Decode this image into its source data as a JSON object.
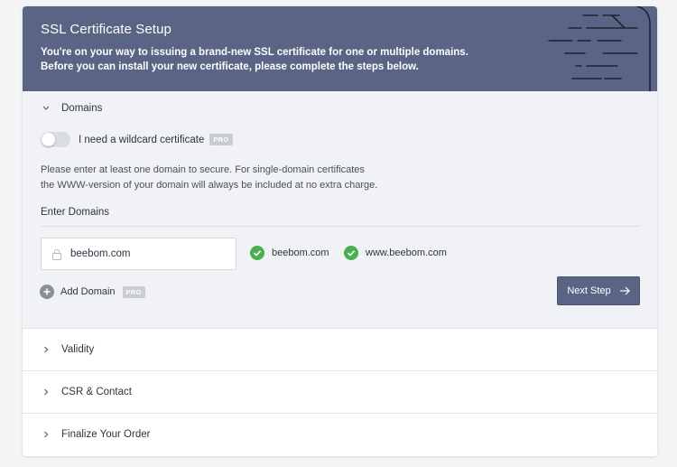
{
  "header": {
    "title": "SSL Certificate Setup",
    "desc_line1": "You're on your way to issuing a brand-new SSL certificate for one or multiple domains.",
    "desc_line2": "Before you can install your new certificate, please complete the steps below."
  },
  "domains_section": {
    "label": "Domains",
    "wildcard_label": "I need a wildcard certificate",
    "wildcard_enabled": false,
    "pro_badge": "PRO",
    "help_line1": "Please enter at least one domain to secure. For single-domain certificates",
    "help_line2": "the WWW-version of your domain will always be included at no extra charge.",
    "enter_label": "Enter Domains",
    "input_value": "beebom.com",
    "verified": [
      "beebom.com",
      "www.beebom.com"
    ],
    "add_domain_label": "Add Domain",
    "next_label": "Next Step"
  },
  "sections": [
    {
      "label": "Validity"
    },
    {
      "label": "CSR & Contact"
    },
    {
      "label": "Finalize Your Order"
    }
  ],
  "colors": {
    "header_bg": "#5a6484",
    "success": "#4caf50",
    "button": "#5a6484"
  }
}
